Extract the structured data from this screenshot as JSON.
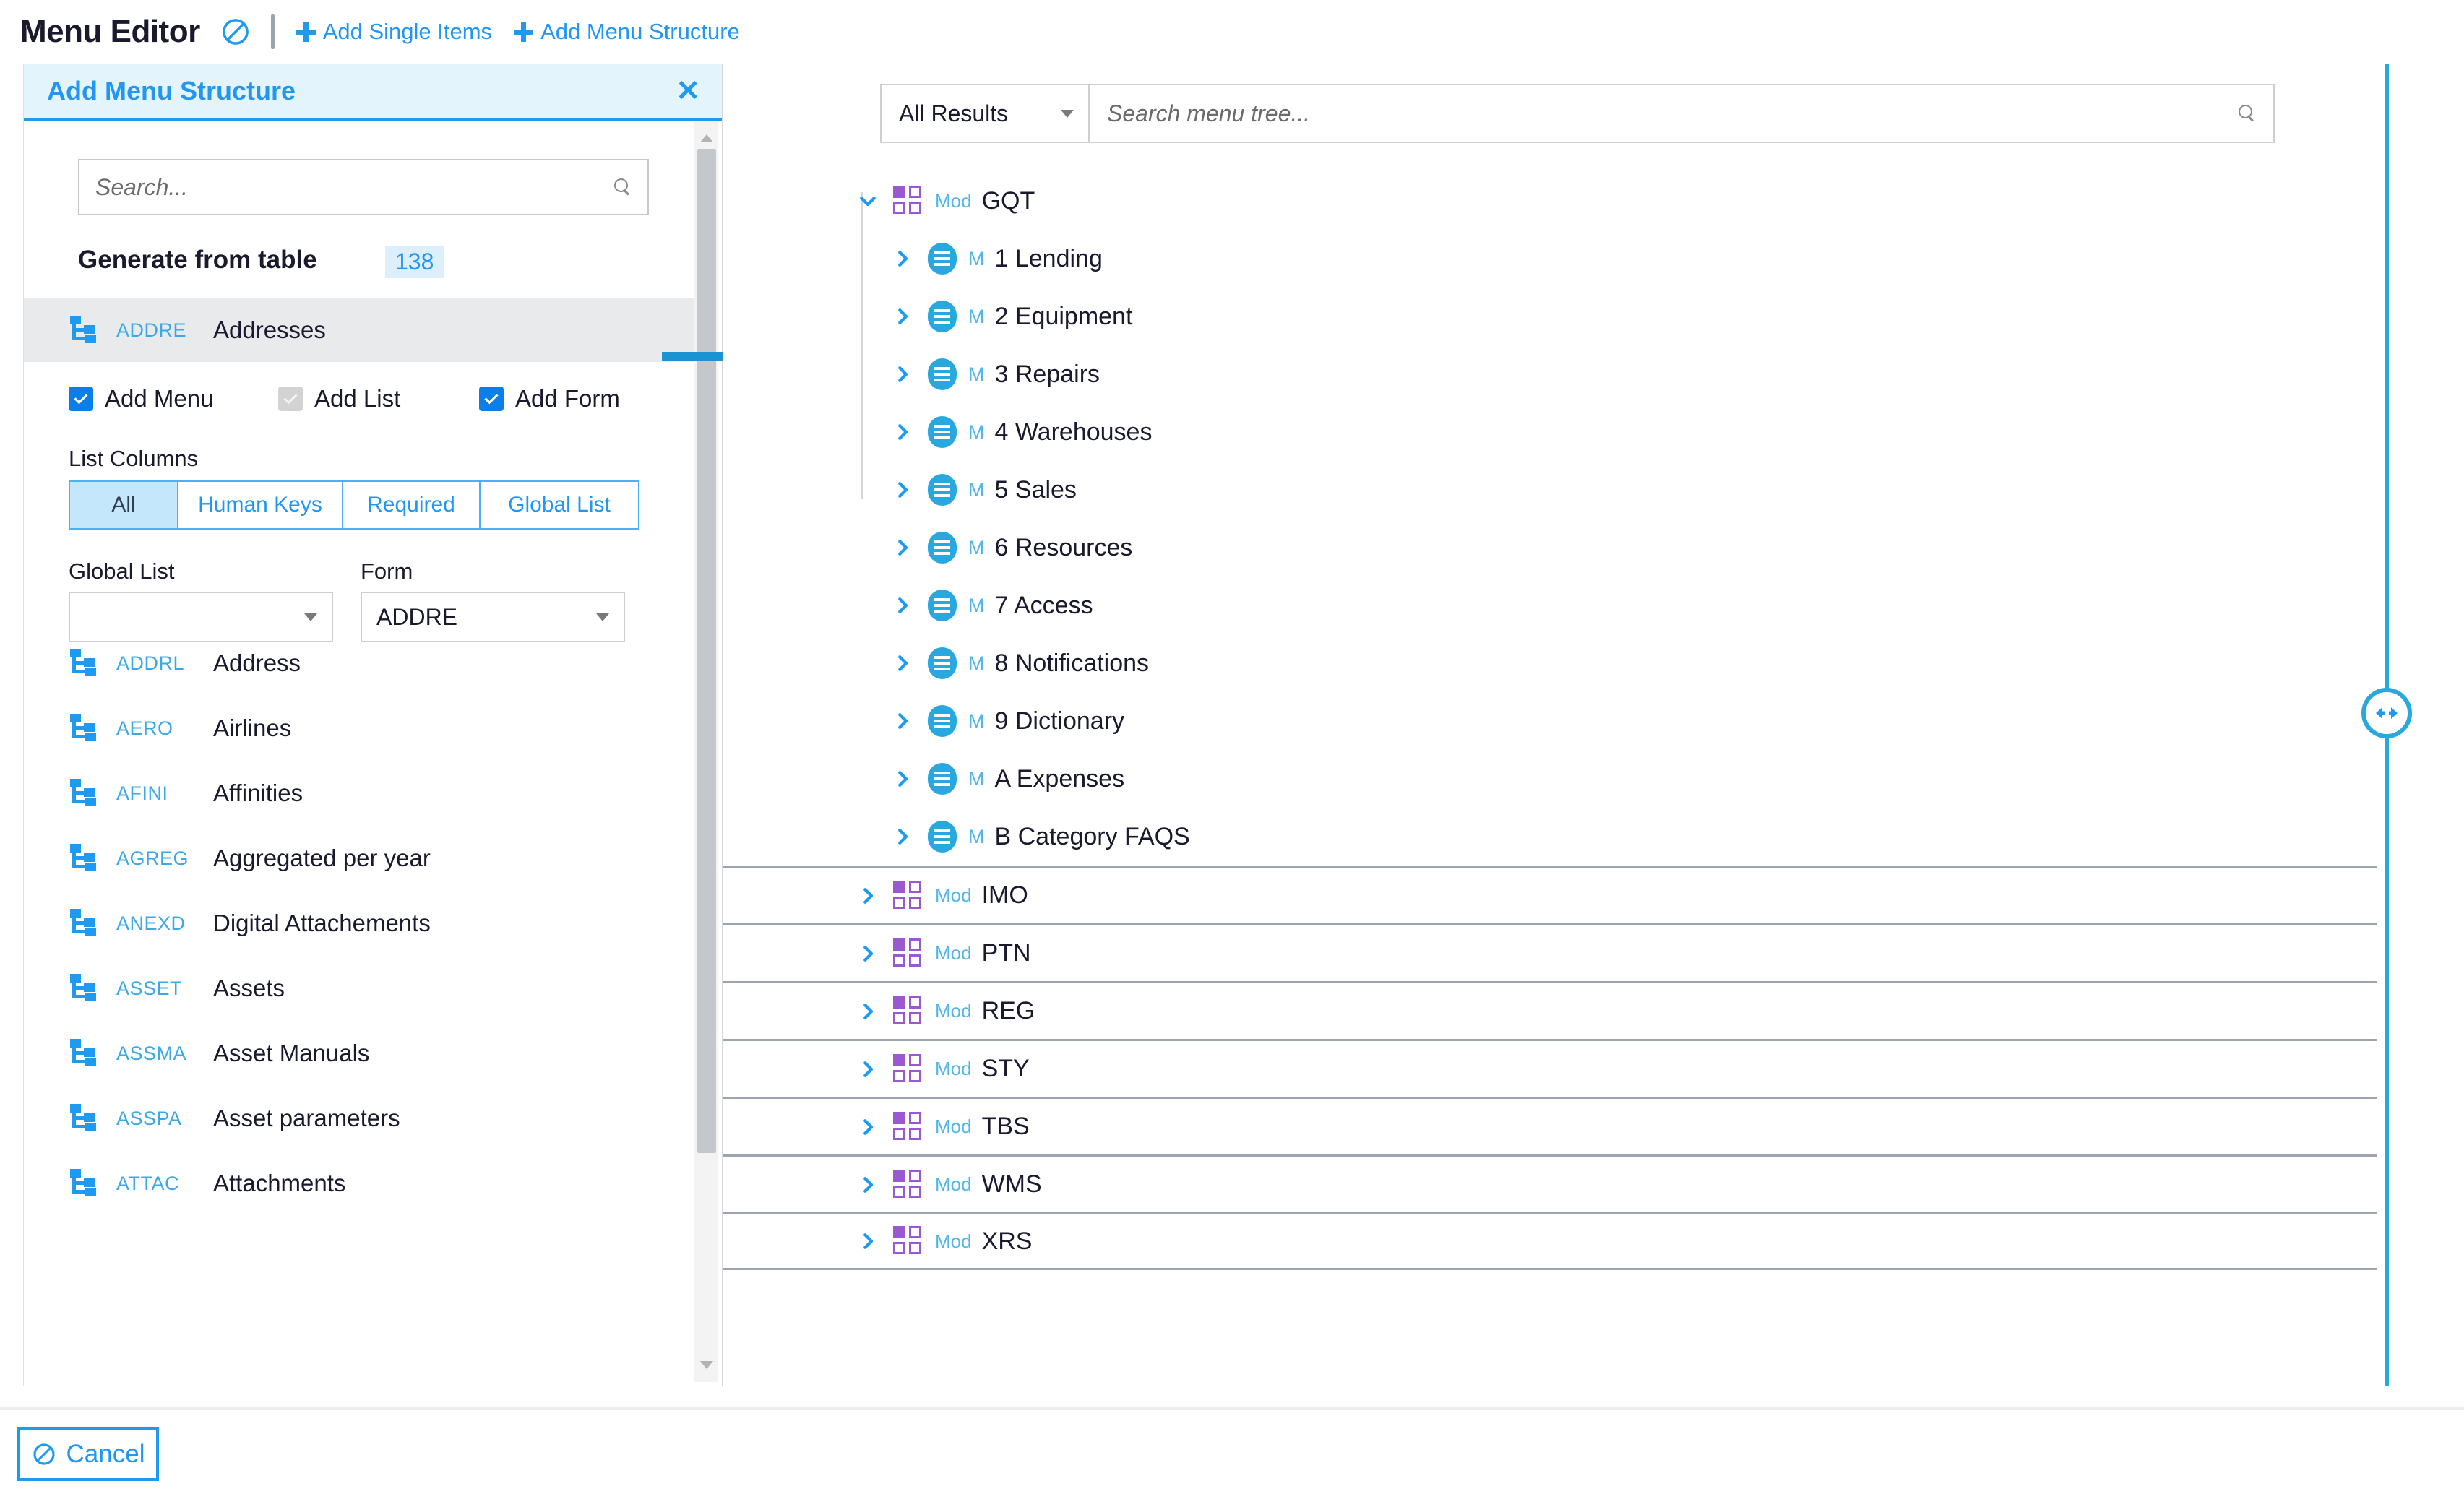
{
  "toolbar": {
    "title": "Menu Editor",
    "block_icon": "block-icon",
    "actions": [
      {
        "label": "Add Single Items",
        "icon": "plus-icon"
      },
      {
        "label": "Add Menu Structure",
        "icon": "plus-icon"
      }
    ]
  },
  "left_panel": {
    "title": "Add Menu Structure",
    "close_icon": "close-icon",
    "search": {
      "value": "",
      "placeholder": "Search...",
      "icon": "search-icon"
    },
    "generate_label": "Generate from table",
    "generate_count": "138",
    "expanded_item": {
      "code": "ADDRE",
      "name": "Addresses",
      "icon": "table-structure-icon",
      "checkboxes": [
        {
          "label": "Add Menu",
          "checked": true,
          "disabled": false
        },
        {
          "label": "Add List",
          "checked": true,
          "disabled": true
        },
        {
          "label": "Add Form",
          "checked": true,
          "disabled": false
        }
      ],
      "list_columns_label": "List Columns",
      "list_columns_options": [
        "All",
        "Human Keys",
        "Required",
        "Global List"
      ],
      "list_columns_selected": "All",
      "global_list_label": "Global List",
      "global_list_value": "",
      "form_label": "Form",
      "form_value": "ADDRE"
    },
    "items": [
      {
        "code": "ADDRL",
        "name": "Address"
      },
      {
        "code": "AERO",
        "name": "Airlines"
      },
      {
        "code": "AFINI",
        "name": "Affinities"
      },
      {
        "code": "AGREG",
        "name": "Aggregated per year"
      },
      {
        "code": "ANEXD",
        "name": "Digital Attachements"
      },
      {
        "code": "ASSET",
        "name": "Assets"
      },
      {
        "code": "ASSMA",
        "name": "Asset Manuals"
      },
      {
        "code": "ASSPA",
        "name": "Asset parameters"
      },
      {
        "code": "ATTAC",
        "name": "Attachments"
      }
    ],
    "scrollbar": {
      "up_icon": "caret-up-icon",
      "down_icon": "caret-down-icon"
    }
  },
  "drag_hint": {
    "arrow_icon": "arrow-right-icon",
    "drop_target_icon": "dashed-drop-target"
  },
  "right_panel": {
    "filter": {
      "selected": "All Results",
      "caret_icon": "chevron-down-icon"
    },
    "search": {
      "value": "",
      "placeholder": "Search menu tree...",
      "icon": "search-icon"
    },
    "tree": {
      "root": {
        "tag": "Mod",
        "label": "GQT",
        "expanded": true,
        "icon": "module-grid-icon",
        "twisty_icon": "chevron-down-icon",
        "children": [
          {
            "tag": "M",
            "label": "1 Lending"
          },
          {
            "tag": "M",
            "label": "2 Equipment"
          },
          {
            "tag": "M",
            "label": "3 Repairs"
          },
          {
            "tag": "M",
            "label": "4 Warehouses"
          },
          {
            "tag": "M",
            "label": "5 Sales"
          },
          {
            "tag": "M",
            "label": "6 Resources"
          },
          {
            "tag": "M",
            "label": "7 Access"
          },
          {
            "tag": "M",
            "label": "8 Notifications"
          },
          {
            "tag": "M",
            "label": "9 Dictionary"
          },
          {
            "tag": "M",
            "label": "A Expenses"
          },
          {
            "tag": "M",
            "label": "B Category FAQS"
          }
        ]
      },
      "modules": [
        {
          "tag": "Mod",
          "label": "IMO"
        },
        {
          "tag": "Mod",
          "label": "PTN"
        },
        {
          "tag": "Mod",
          "label": "REG"
        },
        {
          "tag": "Mod",
          "label": "STY"
        },
        {
          "tag": "Mod",
          "label": "TBS"
        },
        {
          "tag": "Mod",
          "label": "WMS"
        },
        {
          "tag": "Mod",
          "label": "XRS"
        }
      ]
    }
  },
  "resizer": {
    "icon": "resize-horizontal-icon"
  },
  "footer": {
    "cancel_label": "Cancel",
    "cancel_icon": "block-icon"
  },
  "colors": {
    "accent": "#2196f3",
    "accent_strong": "#1e9bf0",
    "module_purple": "#9b59d0",
    "menu_blue": "#29a8e0",
    "header_bg": "#e3f4fd",
    "card_head_bg": "#e8eaec",
    "badge_bg": "#ddeffc",
    "arrow_blue": "#1b92d1"
  }
}
